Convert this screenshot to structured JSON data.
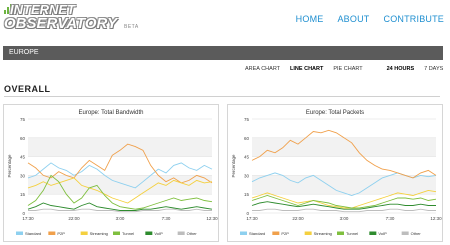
{
  "header": {
    "logo_line1": "INTERNET",
    "logo_line2": "OBSERVATORY",
    "logo_suffix": "BETA",
    "nav": [
      "HOME",
      "ABOUT",
      "CONTRIBUTE"
    ]
  },
  "region": {
    "title": "EUROPE"
  },
  "chart_tabs": {
    "types": [
      "AREA CHART",
      "LINE CHART",
      "PIE CHART"
    ],
    "active_type": "LINE CHART",
    "ranges": [
      "24 HOURS",
      "7 DAYS"
    ],
    "active_range": "24 HOURS"
  },
  "section": {
    "title": "OVERALL"
  },
  "colors": {
    "Standard": "#8ed0ef",
    "P2P": "#f0a04b",
    "Streaming": "#f4d03f",
    "Tunnel": "#7fbf3f",
    "VoIP": "#2e8b2e",
    "Other": "#bdbdbd"
  },
  "chart_data": [
    {
      "type": "line",
      "title": "Europe: Total Bandwidth",
      "ylabel": "Percentage",
      "xlabel": "",
      "ylim": [
        0,
        75
      ],
      "yticks": [
        0,
        15,
        30,
        45,
        60,
        75
      ],
      "xticks": [
        "17:30",
        "22:00",
        "3:00",
        "7:30",
        "12:30"
      ],
      "x": [
        0,
        1,
        2,
        3,
        4,
        5,
        6,
        7,
        8,
        9,
        10,
        11,
        12,
        13,
        14,
        15,
        16,
        17,
        18,
        19,
        20,
        21,
        22,
        23,
        24
      ],
      "series": [
        {
          "name": "Standard",
          "values": [
            28,
            30,
            35,
            40,
            36,
            34,
            30,
            33,
            38,
            35,
            30,
            26,
            24,
            22,
            20,
            25,
            30,
            35,
            32,
            38,
            40,
            36,
            34,
            38,
            35
          ]
        },
        {
          "name": "P2P",
          "values": [
            40,
            36,
            30,
            28,
            33,
            30,
            28,
            36,
            42,
            38,
            34,
            46,
            50,
            55,
            53,
            50,
            38,
            30,
            25,
            28,
            24,
            26,
            30,
            28,
            24
          ]
        },
        {
          "name": "Streaming",
          "values": [
            20,
            22,
            25,
            22,
            24,
            26,
            28,
            22,
            20,
            18,
            15,
            12,
            10,
            8,
            12,
            16,
            20,
            24,
            22,
            26,
            24,
            22,
            26,
            24,
            25
          ]
        },
        {
          "name": "Tunnel",
          "values": [
            6,
            10,
            18,
            30,
            25,
            15,
            8,
            12,
            20,
            22,
            14,
            8,
            5,
            4,
            3,
            4,
            6,
            8,
            10,
            12,
            10,
            11,
            12,
            10,
            9
          ]
        },
        {
          "name": "VoIP",
          "values": [
            3,
            5,
            8,
            6,
            5,
            4,
            3,
            6,
            8,
            5,
            4,
            3,
            2,
            2,
            2,
            3,
            3,
            4,
            5,
            4,
            3,
            4,
            5,
            4,
            3
          ]
        },
        {
          "name": "Other",
          "values": [
            2,
            2,
            3,
            3,
            2,
            2,
            2,
            3,
            3,
            2,
            2,
            2,
            1,
            1,
            1,
            2,
            2,
            2,
            3,
            3,
            2,
            2,
            3,
            2,
            2
          ]
        }
      ]
    },
    {
      "type": "line",
      "title": "Europe: Total Packets",
      "ylabel": "Percentage",
      "xlabel": "",
      "ylim": [
        0,
        75
      ],
      "yticks": [
        0,
        15,
        30,
        45,
        60,
        75
      ],
      "xticks": [
        "17:30",
        "22:00",
        "3:00",
        "7:30",
        "12:30"
      ],
      "x": [
        0,
        1,
        2,
        3,
        4,
        5,
        6,
        7,
        8,
        9,
        10,
        11,
        12,
        13,
        14,
        15,
        16,
        17,
        18,
        19,
        20,
        21,
        22,
        23,
        24
      ],
      "series": [
        {
          "name": "Standard",
          "values": [
            25,
            28,
            30,
            32,
            30,
            26,
            24,
            28,
            30,
            26,
            22,
            18,
            16,
            14,
            16,
            20,
            24,
            28,
            30,
            32,
            30,
            28,
            30,
            29,
            30
          ]
        },
        {
          "name": "P2P",
          "values": [
            42,
            45,
            50,
            48,
            52,
            58,
            55,
            60,
            65,
            64,
            66,
            64,
            60,
            56,
            48,
            42,
            38,
            35,
            34,
            32,
            30,
            28,
            32,
            34,
            30
          ]
        },
        {
          "name": "Streaming",
          "values": [
            12,
            14,
            16,
            14,
            12,
            10,
            8,
            9,
            10,
            8,
            6,
            5,
            4,
            4,
            6,
            8,
            10,
            12,
            14,
            16,
            15,
            14,
            16,
            18,
            17
          ]
        },
        {
          "name": "Tunnel",
          "values": [
            10,
            12,
            14,
            12,
            10,
            8,
            6,
            8,
            10,
            9,
            8,
            6,
            5,
            4,
            4,
            5,
            6,
            8,
            10,
            12,
            12,
            11,
            12,
            10,
            11
          ]
        },
        {
          "name": "VoIP",
          "values": [
            6,
            8,
            9,
            8,
            7,
            6,
            5,
            6,
            7,
            6,
            5,
            4,
            3,
            3,
            3,
            4,
            5,
            6,
            7,
            7,
            6,
            6,
            7,
            6,
            6
          ]
        },
        {
          "name": "Other",
          "values": [
            2,
            2,
            3,
            3,
            2,
            2,
            2,
            3,
            3,
            2,
            2,
            2,
            1,
            1,
            1,
            2,
            2,
            2,
            3,
            3,
            2,
            2,
            3,
            2,
            2
          ]
        }
      ]
    }
  ]
}
